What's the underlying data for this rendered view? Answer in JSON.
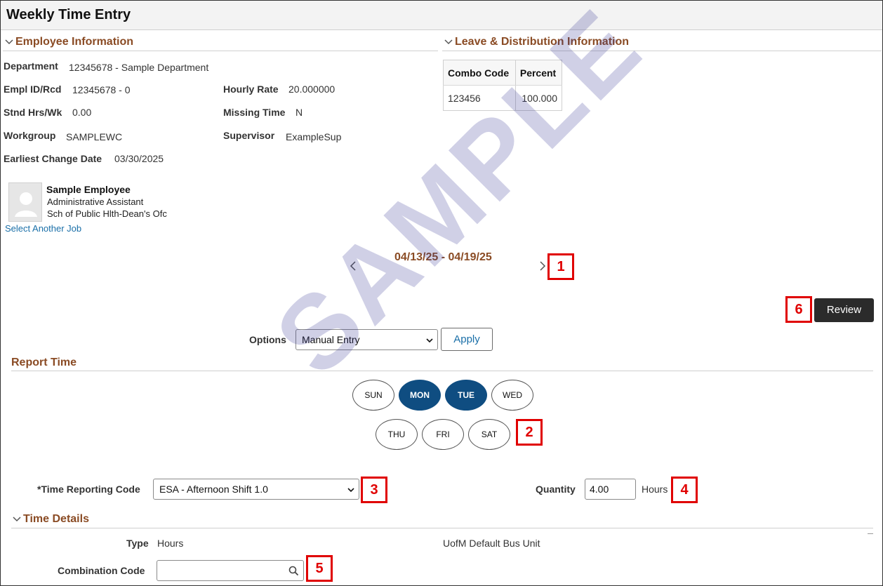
{
  "page_title": "Weekly Time Entry",
  "sections": {
    "employee_info": "Employee Information",
    "leave_dist": "Leave & Distribution Information",
    "report_time": "Report Time",
    "time_details": "Time Details"
  },
  "employee": {
    "department_label": "Department",
    "department_value": "12345678 - Sample Department",
    "emplid_label": "Empl ID/Rcd",
    "emplid_value": "12345678 - 0",
    "hourly_rate_label": "Hourly Rate",
    "hourly_rate_value": "20.000000",
    "stnd_hrs_label": "Stnd Hrs/Wk",
    "stnd_hrs_value": "0.00",
    "missing_time_label": "Missing Time",
    "missing_time_value": "N",
    "workgroup_label": "Workgroup",
    "workgroup_value": "SAMPLEWC",
    "supervisor_label": "Supervisor",
    "supervisor_value": "ExampleSup",
    "earliest_change_label": "Earliest Change Date",
    "earliest_change_value": "03/30/2025",
    "name": "Sample Employee",
    "title": "Administrative Assistant",
    "org": "Sch of Public Hlth-Dean's Ofc",
    "select_another_job": "Select Another Job"
  },
  "distribution": {
    "headers": [
      "Combo Code",
      "Percent"
    ],
    "rows": [
      [
        "123456",
        "100.000"
      ]
    ]
  },
  "period": {
    "range": "04/13/25 - 04/19/25"
  },
  "actions": {
    "review": "Review",
    "options_label": "Options",
    "options_selected": "Manual Entry",
    "apply": "Apply"
  },
  "days": [
    {
      "label": "SUN",
      "selected": false
    },
    {
      "label": "MON",
      "selected": true
    },
    {
      "label": "TUE",
      "selected": true
    },
    {
      "label": "WED",
      "selected": false
    },
    {
      "label": "THU",
      "selected": false
    },
    {
      "label": "FRI",
      "selected": false
    },
    {
      "label": "SAT",
      "selected": false
    }
  ],
  "trc": {
    "label": "*Time Reporting Code",
    "selected": "ESA - Afternoon Shift 1.0"
  },
  "quantity": {
    "label": "Quantity",
    "value": "4.00",
    "unit": "Hours"
  },
  "details": {
    "type_label": "Type",
    "type_value": "Hours",
    "bus_unit_label": "UofM Default Bus Unit",
    "combo_label": "Combination Code",
    "combo_value": ""
  },
  "callouts": [
    "1",
    "2",
    "3",
    "4",
    "5",
    "6"
  ],
  "watermark": "SAMPLE",
  "colors": {
    "section_heading": "#8a4b24",
    "selected_day": "#0f4d81",
    "link": "#1a6fa8",
    "callout": "#e00000"
  }
}
